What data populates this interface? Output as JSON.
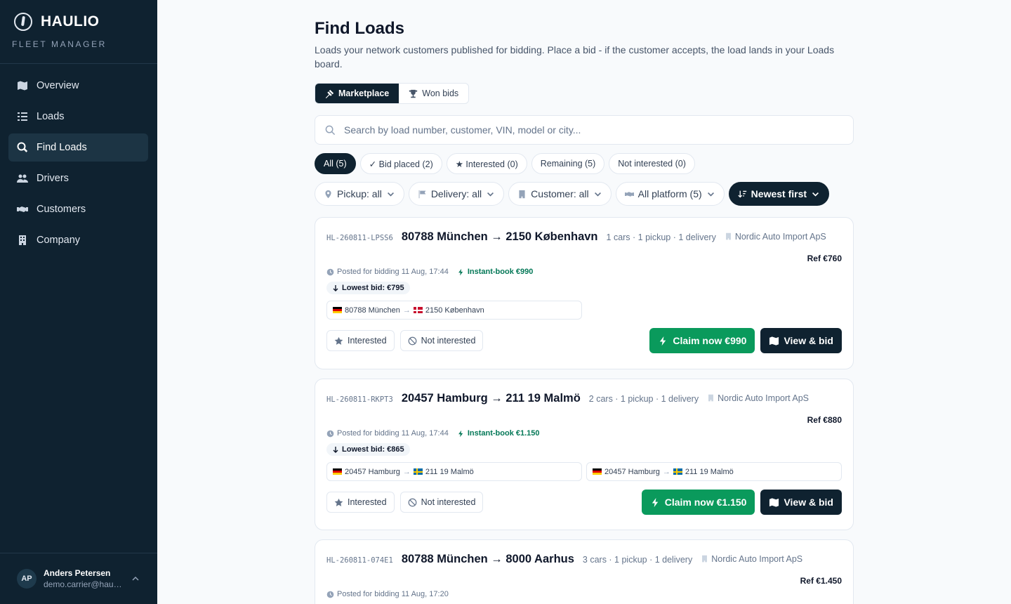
{
  "app": {
    "name": "HAULIO",
    "subtitle": "FLEET MANAGER"
  },
  "sidebar": {
    "items": [
      {
        "label": "Overview",
        "icon": "map-icon"
      },
      {
        "label": "Loads",
        "icon": "list-icon"
      },
      {
        "label": "Find Loads",
        "icon": "search-loads-icon",
        "active": true
      },
      {
        "label": "Drivers",
        "icon": "users-icon"
      },
      {
        "label": "Customers",
        "icon": "handshake-icon"
      },
      {
        "label": "Company",
        "icon": "building-icon"
      }
    ],
    "user": {
      "initials": "AP",
      "name": "Anders Petersen",
      "email": "demo.carrier@haulio.app"
    }
  },
  "page": {
    "title": "Find Loads",
    "description": "Loads your network customers published for bidding. Place a bid - if the customer accepts, the load lands in your Loads board."
  },
  "tabs": {
    "marketplace": "Marketplace",
    "won_bids": "Won bids",
    "active": "Marketplace"
  },
  "search": {
    "placeholder": "Search by load number, customer, VIN, model or city..."
  },
  "status_chips": [
    "All (5)",
    "✓ Bid placed (2)",
    "★ Interested (0)",
    "Remaining (5)",
    "Not interested (0)"
  ],
  "filters": {
    "pickup": "Pickup: all",
    "delivery": "Delivery: all",
    "customer": "Customer: all",
    "platform": "All platform (5)",
    "sort": "Newest first"
  },
  "labels": {
    "interested": "Interested",
    "not_interested": "Not interested",
    "view_bid": "View & bid"
  },
  "colors": {
    "sidebar_bg": "#0f2230",
    "accent_green": "#0a9a5c",
    "instant_green": "#047857"
  },
  "loads": [
    {
      "id": "HL-260811-LPSS6",
      "route": "80788 München → 2150 København",
      "meta": "1 cars · 1 pickup · 1 delivery",
      "customer": "Nordic Auto Import ApS",
      "ref": "Ref €760",
      "posted": "Posted for bidding 11 Aug, 17:44",
      "instant": "Instant-book €990",
      "lowest": "Lowest bid: €795",
      "legs": [
        {
          "from": "80788 München",
          "to": "2150 København"
        }
      ],
      "claim": "Claim now €990"
    },
    {
      "id": "HL-260811-RKPT3",
      "route": "20457 Hamburg → 211 19 Malmö",
      "meta": "2 cars · 1 pickup · 1 delivery",
      "customer": "Nordic Auto Import ApS",
      "ref": "Ref €880",
      "posted": "Posted for bidding 11 Aug, 17:44",
      "instant": "Instant-book €1.150",
      "lowest": "Lowest bid: €865",
      "legs": [
        {
          "from": "20457 Hamburg",
          "to": "211 19 Malmö"
        },
        {
          "from": "20457 Hamburg",
          "to": "211 19 Malmö"
        }
      ],
      "claim": "Claim now €1.150"
    },
    {
      "id": "HL-260811-074E1",
      "route": "80788 München → 8000 Aarhus",
      "meta": "3 cars · 1 pickup · 1 delivery",
      "customer": "Nordic Auto Import ApS",
      "ref": "Ref €1.450",
      "posted": "Posted for bidding 11 Aug, 17:20"
    }
  ]
}
